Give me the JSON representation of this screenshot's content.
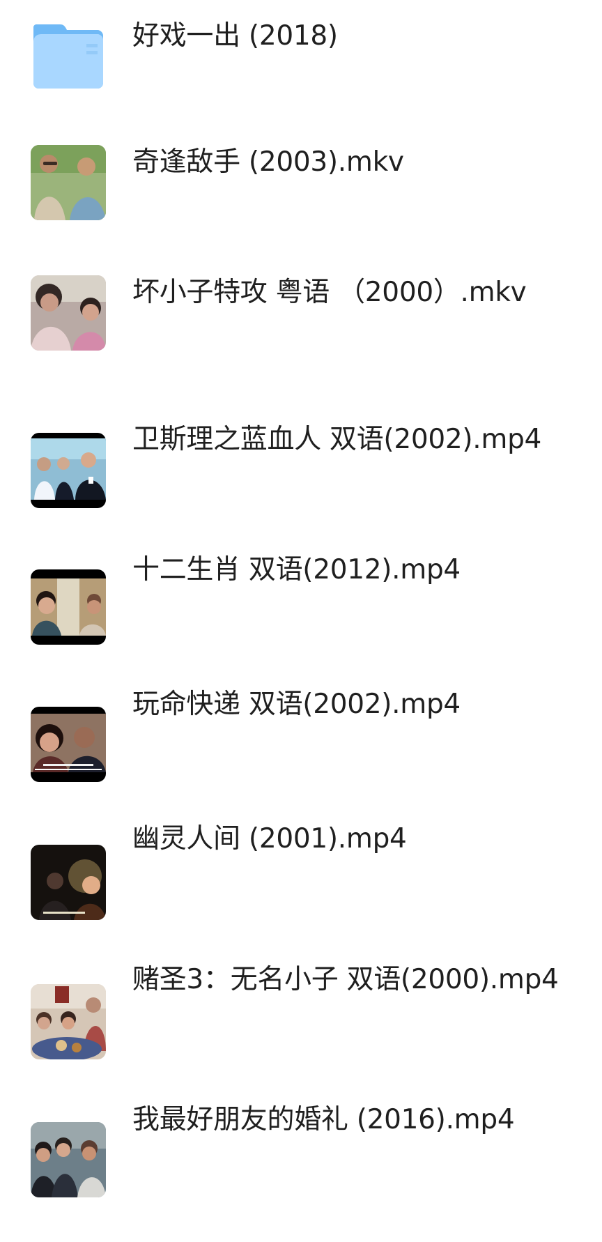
{
  "files": [
    {
      "name": "好戏一出 (2018)",
      "type": "folder",
      "thumbnail": "folder-icon",
      "meta": ""
    },
    {
      "name": "奇逢敌手 (2003).mkv",
      "type": "video",
      "thumbnail": "video-thumbnail-outdoor-scene",
      "meta": ""
    },
    {
      "name": "坏小子特攻 粤语 （2000）.mkv",
      "type": "video",
      "thumbnail": "video-thumbnail-two-actresses",
      "meta": ""
    },
    {
      "name": "卫斯理之蓝血人 双语(2002).mp4",
      "type": "video",
      "thumbnail": "video-thumbnail-office-scene",
      "meta": ""
    },
    {
      "name": "十二生肖 双语(2012).mp4",
      "type": "video",
      "thumbnail": "video-thumbnail-dialogue-scene",
      "meta": ""
    },
    {
      "name": "玩命快递 双语(2002).mp4",
      "type": "video",
      "thumbnail": "video-thumbnail-subtitled-scene",
      "meta": ""
    },
    {
      "name": "幽灵人间 (2001).mp4",
      "type": "video",
      "thumbnail": "video-thumbnail-dark-scene",
      "meta": ""
    },
    {
      "name": "赌圣3：无名小子 双语(2000).mp4",
      "type": "video",
      "thumbnail": "video-thumbnail-dinner-scene",
      "meta": ""
    },
    {
      "name": "我最好朋友的婚礼 (2016).mp4",
      "type": "video",
      "thumbnail": "video-thumbnail-group-scene",
      "meta": ""
    }
  ],
  "colors": {
    "background": "#ffffff",
    "text": "#1f1f1f",
    "folder_blue": "#70b9f6",
    "folder_front": "#a4d5ff"
  }
}
